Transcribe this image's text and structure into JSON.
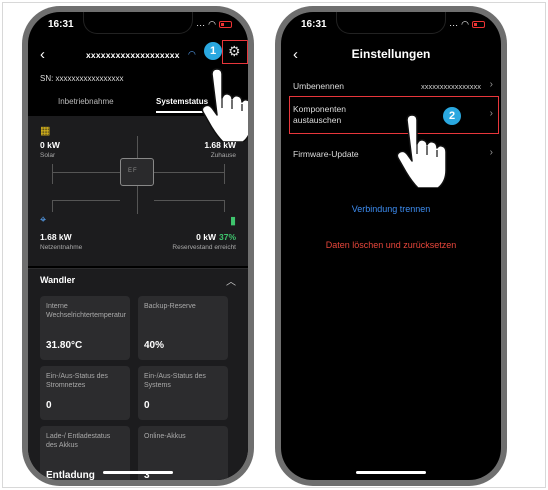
{
  "screen1": {
    "status_time": "16:31",
    "title": "xxxxxxxxxxxxxxxxxxx",
    "sn": "SN: xxxxxxxxxxxxxxxxx",
    "tabs": [
      "Inbetriebnahme",
      "Systemstatus"
    ],
    "flow": {
      "solar_value": "0 kW",
      "solar_label": "Solar",
      "home_value": "1.68 kW",
      "home_label": "Zuhause",
      "inverter_label": "EF",
      "grid_value": "1.68 kW",
      "grid_label": "Netzentnahme",
      "battery_value": "0 kW",
      "battery_percent": "37%",
      "battery_label": "Reservestand erreicht"
    },
    "section_title": "Wandler",
    "cards": [
      {
        "label": "Interne Wechselrichtertemperatur",
        "value": "31.80°C"
      },
      {
        "label": "Backup-Reserve",
        "value": "40%"
      },
      {
        "label": "Ein-/Aus-Status des Stromnetzes",
        "value": "0"
      },
      {
        "label": "Ein-/Aus-Status des Systems",
        "value": "0"
      },
      {
        "label": "Lade-/ Entladestatus des Akkus",
        "value": "Entladung"
      },
      {
        "label": "Online-Akkus",
        "value": "3"
      }
    ],
    "badge": "1"
  },
  "screen2": {
    "status_time": "16:31",
    "title": "Einstellungen",
    "rename_label": "Umbenennen",
    "rename_value": "xxxxxxxxxxxxxxxx",
    "components_label_line1": "Komponenten",
    "components_label_line2": "austauschen",
    "firmware_label": "Firmware-Update",
    "disconnect_label": "Verbindung trennen",
    "delete_label": "Daten löschen und zurücksetzen",
    "badge": "2"
  },
  "colors": {
    "highlight": "#e8363b",
    "badge": "#2aa8e0",
    "link_blue": "#3d8cf0",
    "link_red": "#e8463b",
    "battery_green": "#3ec46d",
    "solar_yellow": "#e8c21b"
  }
}
